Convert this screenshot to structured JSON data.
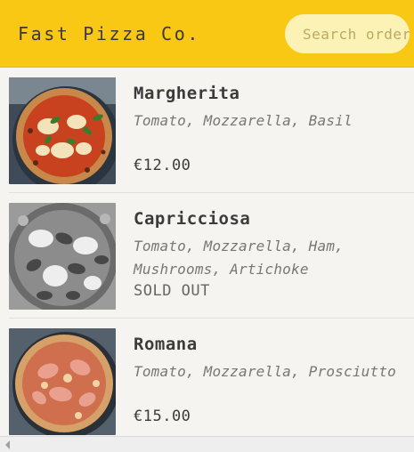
{
  "header": {
    "brand": "Fast Pizza Co.",
    "search_placeholder": "Search order #"
  },
  "menu": {
    "items": [
      {
        "name": "Margherita",
        "ingredients": "Tomato, Mozzarella, Basil",
        "price": "€12.00",
        "sold_out": false
      },
      {
        "name": "Capricciosa",
        "ingredients": "Tomato, Mozzarella, Ham, Mushrooms, Artichoke",
        "price": "SOLD OUT",
        "sold_out": true
      },
      {
        "name": "Romana",
        "ingredients": "Tomato, Mozzarella, Prosciutto",
        "price": "€15.00",
        "sold_out": false
      }
    ]
  },
  "colors": {
    "header_bg": "#f9c815",
    "search_bg": "#fcf2b6",
    "page_bg": "#f5f4f0"
  }
}
